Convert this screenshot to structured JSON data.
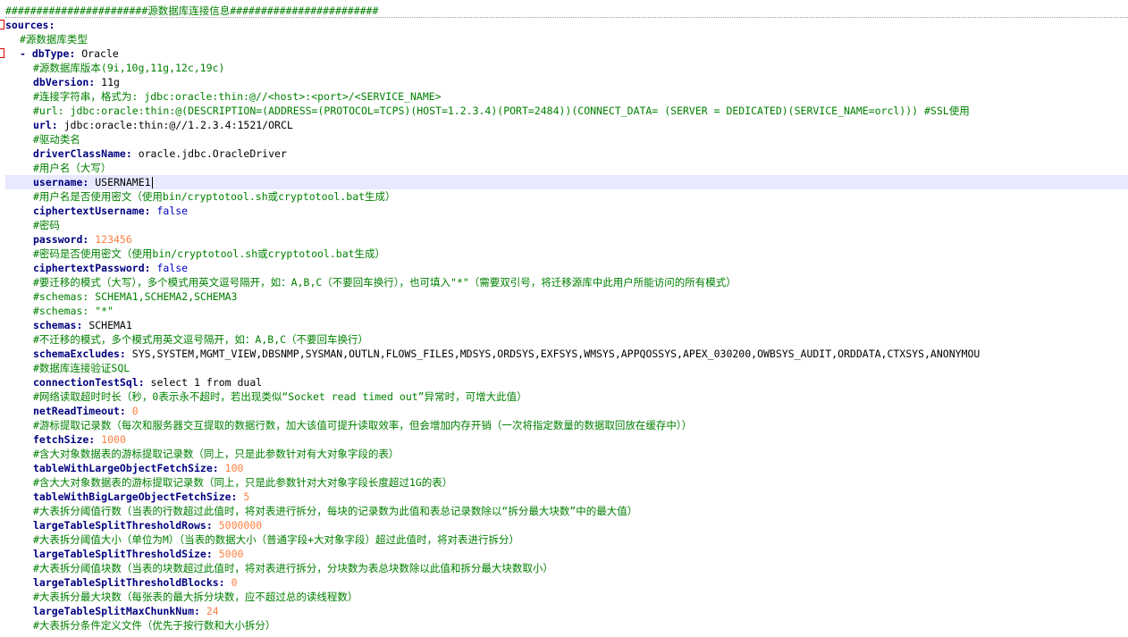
{
  "header_comment": "#######################源数据库连接信息########################",
  "sources_key": "sources:",
  "db_type_comment": "#源数据库类型",
  "dash": "- ",
  "lines": {
    "dbType": {
      "key": "dbType:",
      "value": " Oracle"
    },
    "c_dbVersion": "#源数据库版本(9i,10g,11g,12c,19c)",
    "dbVersion": {
      "key": "dbVersion:",
      "value": " 11g"
    },
    "c_url": "#连接字符串，格式为: jdbc:oracle:thin:@//<host>:<port>/<SERVICE_NAME>",
    "c_url_ssl": "#url: jdbc:oracle:thin:@(DESCRIPTION=(ADDRESS=(PROTOCOL=TCPS)(HOST=1.2.3.4)(PORT=2484))(CONNECT_DATA= (SERVER = DEDICATED)(SERVICE_NAME=orcl))) #SSL使用",
    "url": {
      "key": "url:",
      "value": " jdbc:oracle:thin:@//1.2.3.4:1521/ORCL"
    },
    "c_driver": "#驱动类名",
    "driverClassName": {
      "key": "driverClassName:",
      "value": " oracle.jdbc.OracleDriver"
    },
    "c_username": "#用户名（大写）",
    "username": {
      "key": "username:",
      "value": " USERNAME1"
    },
    "c_cipher_user": "#用户名是否使用密文（使用bin/cryptotool.sh或cryptotool.bat生成）",
    "ciphertextUsername": {
      "key": "ciphertextUsername:",
      "value": " false"
    },
    "c_password": "#密码",
    "password": {
      "key": "password:",
      "value": " 123456"
    },
    "c_cipher_pwd": "#密码是否使用密文（使用bin/cryptotool.sh或cryptotool.bat生成）",
    "ciphertextPassword": {
      "key": "ciphertextPassword:",
      "value": " false"
    },
    "c_schemas": "#要迁移的模式（大写），多个模式用英文逗号隔开，如：A,B,C（不要回车换行），也可填入\"*\"（需要双引号，将迁移源库中此用户所能访问的所有模式）",
    "c_schemas_ex1": "#schemas: SCHEMA1,SCHEMA2,SCHEMA3",
    "c_schemas_ex2": "#schemas: \"*\"",
    "schemas": {
      "key": "schemas:",
      "value": " SCHEMA1"
    },
    "c_excludes": "#不迁移的模式，多个模式用英文逗号隔开，如：A,B,C（不要回车换行）",
    "schemaExcludes": {
      "key": "schemaExcludes:",
      "value": " SYS,SYSTEM,MGMT_VIEW,DBSNMP,SYSMAN,OUTLN,FLOWS_FILES,MDSYS,ORDSYS,EXFSYS,WMSYS,APPQOSSYS,APEX_030200,OWBSYS_AUDIT,ORDDATA,CTXSYS,ANONYMOU"
    },
    "c_testsql": "#数据库连接验证SQL",
    "connectionTestSql": {
      "key": "connectionTestSql:",
      "value": " select 1 from dual"
    },
    "c_timeout": "#网络读取超时时长（秒，0表示永不超时，若出现类似“Socket read timed out”异常时，可增大此值）",
    "netReadTimeout": {
      "key": "netReadTimeout:",
      "value": " 0"
    },
    "c_fetch": "#游标提取记录数（每次和服务器交互提取的数据行数，加大该值可提升读取效率，但会增加内存开销（一次将指定数量的数据取回放在缓存中））",
    "fetchSize": {
      "key": "fetchSize:",
      "value": " 1000"
    },
    "c_lob_fetch": "#含大对象数据表的游标提取记录数（同上，只是此参数针对有大对象字段的表）",
    "tableWithLargeObjectFetchSize": {
      "key": "tableWithLargeObjectFetchSize:",
      "value": " 100"
    },
    "c_big_lob_fetch": "#含大大对象数据表的游标提取记录数（同上，只是此参数针对大对象字段长度超过1G的表）",
    "tableWithBigLargeObjectFetchSize": {
      "key": "tableWithBigLargeObjectFetchSize:",
      "value": " 5"
    },
    "c_split_rows": "#大表拆分阈值行数（当表的行数超过此值时，将对表进行拆分，每块的记录数为此值和表总记录数除以“拆分最大块数”中的最大值）",
    "largeTableSplitThresholdRows": {
      "key": "largeTableSplitThresholdRows:",
      "value": " 5000000"
    },
    "c_split_size": "#大表拆分阈值大小（单位为M）（当表的数据大小（普通字段+大对象字段）超过此值时，将对表进行拆分）",
    "largeTableSplitThresholdSize": {
      "key": "largeTableSplitThresholdSize:",
      "value": " 5000"
    },
    "c_split_blocks": "#大表拆分阈值块数（当表的块数超过此值时，将对表进行拆分，分块数为表总块数除以此值和拆分最大块数取小）",
    "largeTableSplitThresholdBlocks": {
      "key": "largeTableSplitThresholdBlocks:",
      "value": " 0"
    },
    "c_split_max": "#大表拆分最大块数（每张表的最大拆分块数，应不超过总的读线程数）",
    "largeTableSplitMaxChunkNum": {
      "key": "largeTableSplitMaxChunkNum:",
      "value": " 24"
    },
    "c_split_def": "#大表拆分条件定义文件（优先于按行数和大小拆分）"
  },
  "colors": {
    "comment": "#008000",
    "key": "#000080",
    "number": "#ff8040",
    "boolean": "#0000c0",
    "fold_marker": "#d80000",
    "current_line": "#e8e8ff"
  }
}
